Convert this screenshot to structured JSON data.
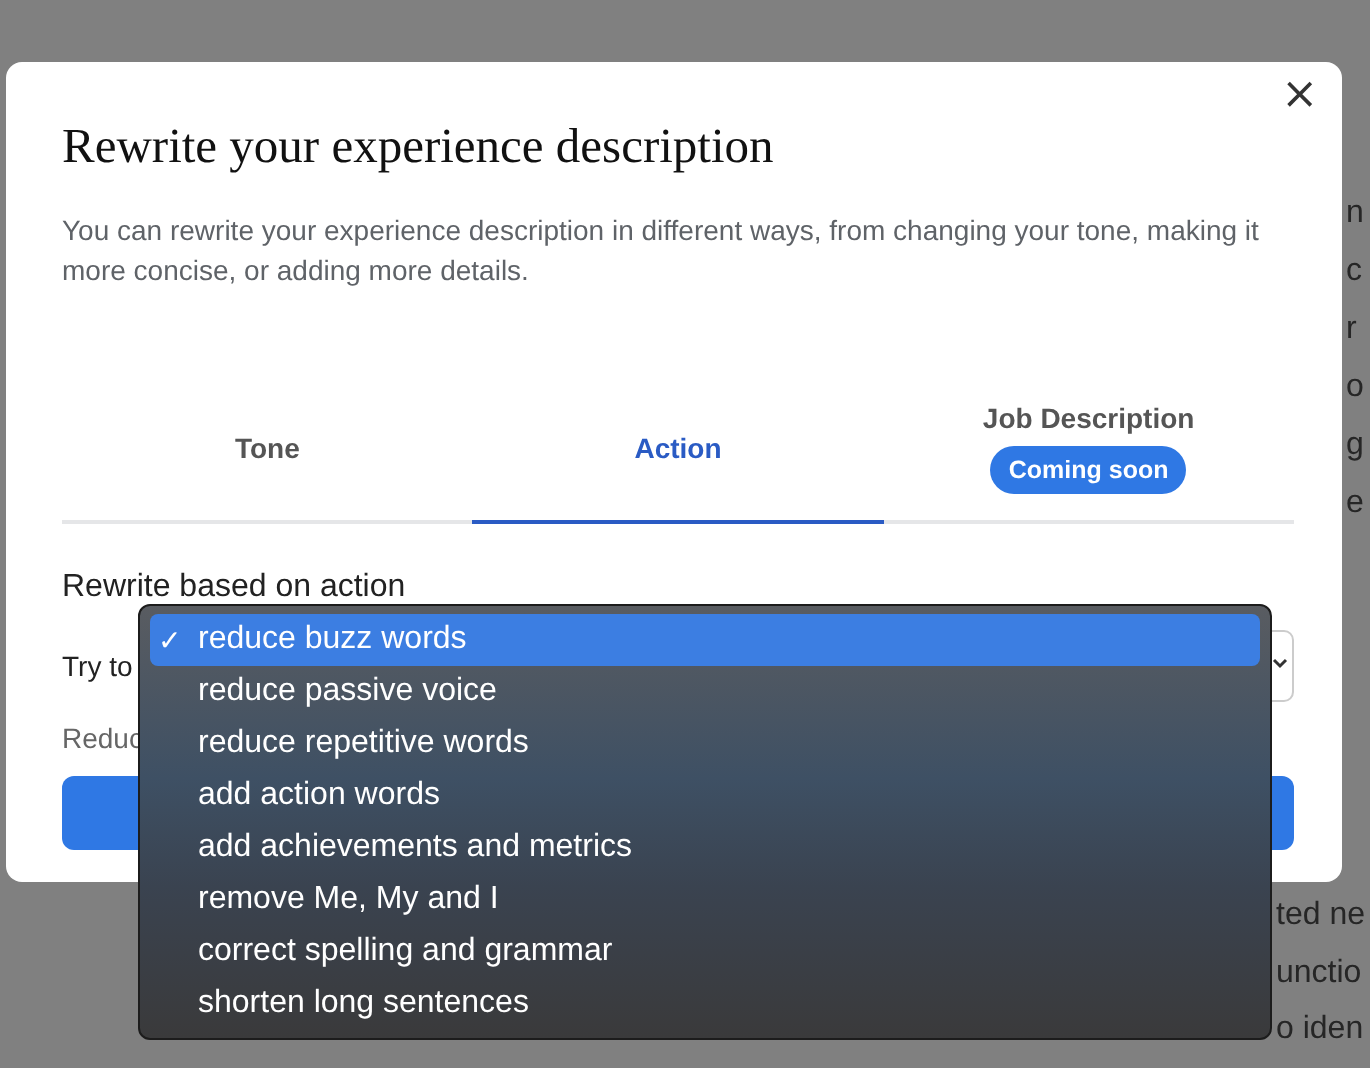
{
  "background_text": {
    "right": [
      "n",
      "c",
      "r",
      "o",
      "g",
      "e"
    ],
    "bottom": [
      "ted ne",
      "unctio",
      "o iden"
    ]
  },
  "dialog": {
    "close": "×",
    "title": "Rewrite your experience description",
    "description": "You can rewrite your experience description in different ways, from changing your tone, making it more concise, or adding more details.",
    "tabs": [
      {
        "label": "Tone",
        "selected": false
      },
      {
        "label": "Action",
        "selected": true
      },
      {
        "label": "Job Description",
        "badge": "Coming soon",
        "selected": false
      }
    ],
    "section_title": "Rewrite based on action",
    "select_label": "Try to",
    "hint": "Reduc",
    "dropdown": {
      "expanded": true,
      "check_mark": "✓",
      "options": [
        {
          "label": "reduce buzz words",
          "selected": true
        },
        {
          "label": "reduce passive voice",
          "selected": false
        },
        {
          "label": "reduce repetitive words",
          "selected": false
        },
        {
          "label": "add action words",
          "selected": false
        },
        {
          "label": "add achievements and metrics",
          "selected": false
        },
        {
          "label": "remove Me, My and I",
          "selected": false
        },
        {
          "label": "correct spelling and grammar",
          "selected": false
        },
        {
          "label": "shorten long sentences",
          "selected": false
        }
      ]
    }
  }
}
